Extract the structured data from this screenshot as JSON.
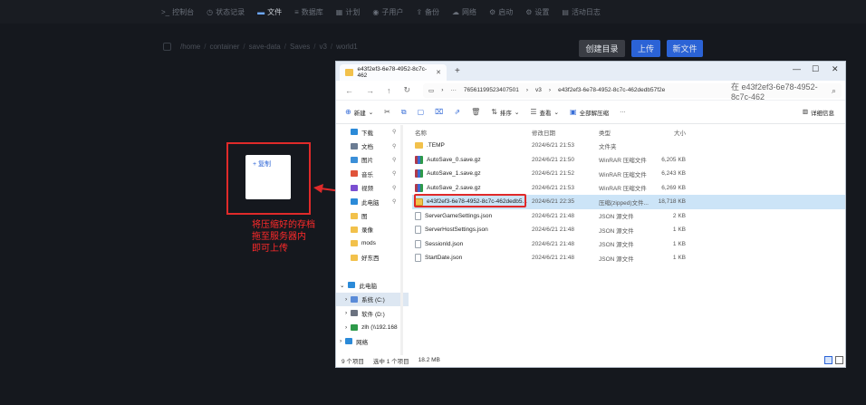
{
  "nav": {
    "items": [
      {
        "icon": "terminal-icon",
        "glyph": ">_",
        "label": "控制台"
      },
      {
        "icon": "clock-icon",
        "glyph": "◷",
        "label": "状态记录"
      },
      {
        "icon": "folder-icon",
        "glyph": "▬",
        "label": "文件",
        "active": true
      },
      {
        "icon": "database-icon",
        "glyph": "≡",
        "label": "数据库"
      },
      {
        "icon": "calendar-icon",
        "glyph": "▦",
        "label": "计划"
      },
      {
        "icon": "user-icon",
        "glyph": "◉",
        "label": "子用户"
      },
      {
        "icon": "backup-icon",
        "glyph": "⇪",
        "label": "备份"
      },
      {
        "icon": "network-icon",
        "glyph": "☁",
        "label": "网络"
      },
      {
        "icon": "startup-icon",
        "glyph": "⚙",
        "label": "启动"
      },
      {
        "icon": "settings-icon",
        "glyph": "⚙",
        "label": "设置"
      },
      {
        "icon": "log-icon",
        "glyph": "▤",
        "label": "活动日志"
      }
    ]
  },
  "breadcrumb": {
    "items": [
      "/home",
      "container",
      "save-data",
      "Saves",
      "v3",
      "world1"
    ]
  },
  "buttons": {
    "mkdir": "创建目录",
    "upload": "上传",
    "new_file": "新文件"
  },
  "drag": {
    "copy_label": "+ 复制"
  },
  "note": {
    "lines": [
      "将压缩好的存档",
      "拖至服务器内",
      "即可上传"
    ]
  },
  "colors": {
    "accent": "#2b63d6",
    "annotation": "#e02a2a"
  },
  "explorer": {
    "tab_title": "e43f2ef3-6e78-4952-8c7c-462",
    "path": {
      "segments": [
        "765611995234075​01",
        "v3",
        "e43f2ef3-6e78-4952-8c7c-462dedb57f2e"
      ]
    },
    "search_placeholder": "在 e43f2ef3-6e78-4952-8c7c-462",
    "commands": {
      "new": "新建",
      "sort": "排序",
      "view": "查看",
      "extract": "全部解压缩",
      "details": "详细信息"
    },
    "sidebar": [
      {
        "label": "下载",
        "icon": "download-icon",
        "color": "#2b8ad8",
        "pinned": true
      },
      {
        "label": "文档",
        "icon": "document-icon",
        "color": "#6b7c93",
        "pinned": true
      },
      {
        "label": "图片",
        "icon": "pictures-icon",
        "color": "#3b8fd8",
        "pinned": true
      },
      {
        "label": "音乐",
        "icon": "music-icon",
        "color": "#e0533a",
        "pinned": true
      },
      {
        "label": "视频",
        "icon": "video-icon",
        "color": "#7b4fd1",
        "pinned": true
      },
      {
        "label": "此电脑",
        "icon": "computer-icon",
        "color": "#2b8ad8",
        "pinned": true
      },
      {
        "label": "图",
        "icon": "folder-icon",
        "color": "#f2c14b",
        "pinned": false
      },
      {
        "label": "录像",
        "icon": "folder-icon",
        "color": "#f2c14b",
        "pinned": false
      },
      {
        "label": "mods",
        "icon": "folder-icon",
        "color": "#f2c14b",
        "pinned": false
      },
      {
        "label": "好东西",
        "icon": "folder-icon",
        "color": "#f2c14b",
        "pinned": false
      }
    ],
    "tree": [
      {
        "label": "此电脑",
        "icon": "computer-icon",
        "color": "#2b8ad8",
        "expander": "⌄"
      },
      {
        "label": "系统 (C:)",
        "icon": "drive-icon",
        "color": "#5a8bd8",
        "expander": "›",
        "selected": true
      },
      {
        "label": "软件 (D:)",
        "icon": "drive-icon",
        "color": "#6b7280",
        "expander": "›"
      },
      {
        "label": "zlh (\\\\192.168",
        "icon": "network-drive-icon",
        "color": "#2e9a4a",
        "expander": "›"
      },
      {
        "label": "网络",
        "icon": "network-icon",
        "color": "#2b8ad8",
        "expander": "›"
      }
    ],
    "columns": {
      "name": "名称",
      "date": "修改日期",
      "type": "类型",
      "size": "大小"
    },
    "files": [
      {
        "name": ".TEMP",
        "date": "2024/6/21 21:53",
        "type": "文件夹",
        "size": "",
        "kind": "folder"
      },
      {
        "name": "AutoSave_0.save.gz",
        "date": "2024/6/21 21:50",
        "type": "WinRAR 压缩文件",
        "size": "6,205 KB",
        "kind": "rar"
      },
      {
        "name": "AutoSave_1.save.gz",
        "date": "2024/6/21 21:52",
        "type": "WinRAR 压缩文件",
        "size": "6,243 KB",
        "kind": "rar"
      },
      {
        "name": "AutoSave_2.save.gz",
        "date": "2024/6/21 21:53",
        "type": "WinRAR 压缩文件",
        "size": "6,269 KB",
        "kind": "rar"
      },
      {
        "name": "e43f2ef3-6e78-4952-8c7c-462dedb5...",
        "date": "2024/6/21 22:35",
        "type": "压缩(zipped)文件...",
        "size": "18,718 KB",
        "kind": "zip",
        "selected": true
      },
      {
        "name": "ServerGameSettings.json",
        "date": "2024/6/21 21:48",
        "type": "JSON 源文件",
        "size": "2 KB",
        "kind": "doc"
      },
      {
        "name": "ServerHostSettings.json",
        "date": "2024/6/21 21:48",
        "type": "JSON 源文件",
        "size": "1 KB",
        "kind": "doc"
      },
      {
        "name": "SessionId.json",
        "date": "2024/6/21 21:48",
        "type": "JSON 源文件",
        "size": "1 KB",
        "kind": "doc"
      },
      {
        "name": "StartDate.json",
        "date": "2024/6/21 21:48",
        "type": "JSON 源文件",
        "size": "1 KB",
        "kind": "doc"
      }
    ],
    "status": {
      "count": "9 个项目",
      "selected": "选中 1 个项目",
      "size": "18.2 MB"
    }
  }
}
